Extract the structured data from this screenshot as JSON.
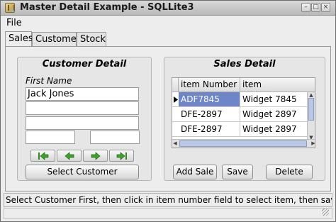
{
  "window": {
    "title": "Master Detail Example - SQLLite3"
  },
  "menu": {
    "file": "File"
  },
  "tabs": [
    {
      "label": "Sales"
    },
    {
      "label": "Customer"
    },
    {
      "label": "Stock"
    }
  ],
  "customer_detail": {
    "title": "Customer Detail",
    "first_name_label": "First Name",
    "first_name_value": "Jack Jones",
    "field2_value": "",
    "field3_value": "",
    "field4_value": "",
    "field5_value": "",
    "nav_icons": [
      "first-record-icon",
      "previous-record-icon",
      "next-record-icon",
      "last-record-icon"
    ],
    "select_button": "Select Customer"
  },
  "sales_detail": {
    "title": "Sales Detail",
    "columns": [
      "item Number",
      "item"
    ],
    "rows": [
      {
        "item_number": "ADF7845",
        "item": "Widget 7845",
        "selected": true
      },
      {
        "item_number": "DFE-2897",
        "item": "Widget 2897"
      },
      {
        "item_number": "DFE-2897",
        "item": "Widget 2897"
      }
    ],
    "add_button": "Add Sale",
    "save_button": "Save",
    "delete_button": "Delete"
  },
  "status": {
    "message": "Select Customer First, then click in item number field to select item, then save"
  },
  "colors": {
    "selection": "#6e86c8",
    "nav_arrow": "#3fa02c"
  }
}
